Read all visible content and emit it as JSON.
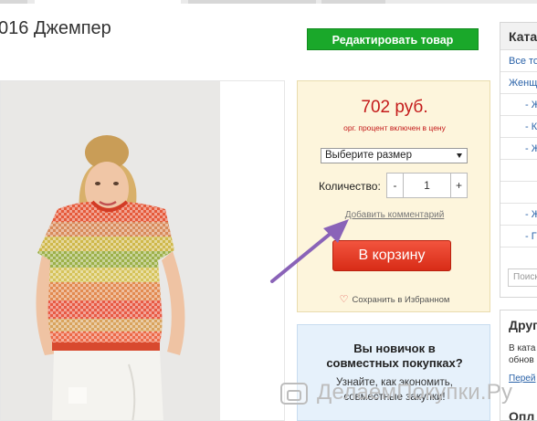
{
  "product": {
    "title": "016 Джемпер",
    "edit_button": "Редактировать товар"
  },
  "buy_box": {
    "price": "702 руб.",
    "price_note": "орг. процент включен в цену",
    "size_select": "Выберите размер",
    "quantity_label": "Количество:",
    "quantity_minus": "-",
    "quantity_value": "1",
    "quantity_plus": "+",
    "comment_link": "Добавить комментарий",
    "cart_button": "В корзину",
    "favorite": "Сохранить в Избранном"
  },
  "newbie_box": {
    "title_line1": "Вы новичок в",
    "title_line2": "совместных покупках?",
    "text_line1": "Узнайте, как экономить,",
    "text_line2": "совместные закупки!"
  },
  "sidebar": {
    "header": "Катал",
    "items": [
      "Все тов",
      "Женщин",
      "- Ж",
      "- К",
      "- Ж",
      "",
      "",
      "- Ж",
      "- Г"
    ],
    "search_placeholder": "Поиск"
  },
  "sidebar2": {
    "header": "Друг",
    "text_line1": "В ката",
    "text_line2": "обнов",
    "link": "Перей",
    "header2": "Опл"
  },
  "watermark": "ДелаемПокупки.Ру",
  "colors": {
    "edit_button": "#1aa82a",
    "price": "#c41a1a",
    "cart_button": "#e0412a",
    "buy_box_bg": "#fdf5dc",
    "newbie_box_bg": "#e6f1fb",
    "arrow": "#8a63b8"
  }
}
